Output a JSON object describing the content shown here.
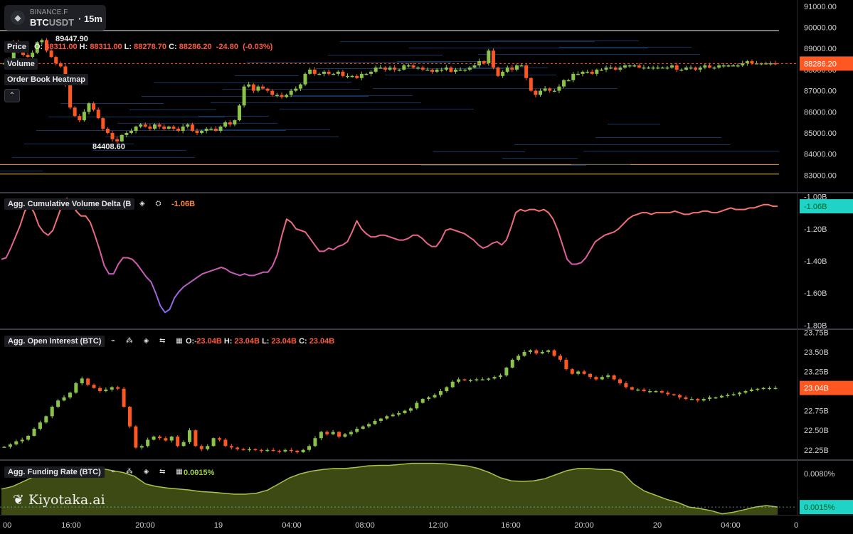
{
  "symbol": {
    "exchange": "BINANCE.F",
    "base": "BTC",
    "quote": "USDT",
    "timeframe": "15m",
    "exchange_icon": "binance-diamond-icon"
  },
  "brand": "Kiyotaka.ai",
  "legend": {
    "price_label": "Price",
    "volume_label": "Volume",
    "heatmap_label": "Order Book Heatmap",
    "o_key": "O:",
    "o_val": "88311.00",
    "h_key": "H:",
    "h_val": "88311.00",
    "l_key": "L:",
    "l_val": "88278.70",
    "c_key": "C:",
    "c_val": "88286.20",
    "change": "-24.80",
    "change_pct": "(-0.03%)",
    "collapse_icon": "chevron-up-icon"
  },
  "colors": {
    "up": "#8bc34a",
    "down": "#ff5722",
    "bg": "#000000",
    "cvd_badge": "#1fd3c6",
    "oi_badge": "#ff5722",
    "funding_fill": "#3d4a14",
    "funding_line": "#a9c44a"
  },
  "time_axis": {
    "labels": [
      "00",
      "16:00",
      "20:00",
      "19",
      "04:00",
      "08:00",
      "12:00",
      "16:00",
      "20:00",
      "20",
      "04:00",
      "0"
    ]
  },
  "chart_data": [
    {
      "type": "candlestick",
      "name": "Price",
      "ylim": [
        82200,
        91300
      ],
      "y_ticks": [
        "91000.00",
        "90000.00",
        "89000.00",
        "88000.00",
        "87000.00",
        "86000.00",
        "85000.00",
        "84000.00",
        "83000.00"
      ],
      "y_tick_values": [
        91000,
        90000,
        89000,
        88000,
        87000,
        86000,
        85000,
        84000,
        83000
      ],
      "last_price": "88286.20",
      "last_value": 88286.2,
      "annotations": [
        {
          "text": "89447.90",
          "value": 89447.9
        },
        {
          "text": "84408.60",
          "value": 84408.6
        }
      ],
      "heatmap_levels": [
        89850,
        83500,
        83050
      ],
      "close_path": [
        88300,
        88500,
        89300,
        88900,
        88700,
        88600,
        88800,
        89300,
        89400,
        88900,
        88600,
        88300,
        88150,
        87300,
        86200,
        85800,
        85600,
        86000,
        86400,
        86100,
        85700,
        85200,
        85000,
        84700,
        84600,
        84900,
        85000,
        85100,
        85300,
        85400,
        85300,
        85200,
        85400,
        85300,
        85200,
        85300,
        85200,
        85100,
        85300,
        85400,
        85100,
        85000,
        85100,
        85200,
        85200,
        85100,
        85300,
        85500,
        85400,
        85600,
        86300,
        87200,
        87300,
        87000,
        87200,
        87100,
        87000,
        86800,
        86800,
        86700,
        86800,
        87000,
        87100,
        87300,
        87800,
        88000,
        87800,
        87800,
        87900,
        87800,
        87800,
        87900,
        87700,
        87700,
        87700,
        87600,
        87800,
        87800,
        87900,
        88100,
        88100,
        88000,
        88100,
        88000,
        88000,
        88200,
        88200,
        88100,
        88100,
        88000,
        88000,
        87900,
        88000,
        88000,
        88100,
        87900,
        88000,
        88000,
        88000,
        88100,
        88200,
        88400,
        88300,
        88900,
        88100,
        87700,
        87900,
        88100,
        88000,
        88200,
        88200,
        87600,
        87000,
        86800,
        87000,
        87100,
        87000,
        87000,
        87200,
        87500,
        87500,
        87800,
        87800,
        87900,
        87900,
        87800,
        88000,
        88000,
        88100,
        88100,
        88000,
        88100,
        88200,
        88200,
        88200,
        88100,
        88100,
        88100,
        88100,
        88100,
        88100,
        88100,
        88200,
        88000,
        88000,
        88100,
        88100,
        88000,
        88100,
        88200,
        88100,
        88100,
        88200,
        88200,
        88200,
        88200,
        88200,
        88300,
        88400,
        88300,
        88300,
        88300,
        88300,
        88300,
        88286
      ]
    },
    {
      "type": "line",
      "name": "Agg. Cumulative Volume Delta (B",
      "value_label": "-1.06B",
      "ylim": [
        -1.82,
        -0.98
      ],
      "y_ticks": [
        "-1.00B",
        "-1.20B",
        "-1.40B",
        "-1.60B",
        "-1.80B"
      ],
      "y_tick_values": [
        -1.0,
        -1.2,
        -1.4,
        -1.6,
        -1.8
      ],
      "last_value": -1.06,
      "points": [
        -1.39,
        -1.38,
        -1.32,
        -1.25,
        -1.18,
        -1.09,
        -1.05,
        -1.1,
        -1.18,
        -1.22,
        -1.24,
        -1.21,
        -1.13,
        -1.05,
        -1.01,
        -1.04,
        -1.09,
        -1.12,
        -1.12,
        -1.16,
        -1.24,
        -1.33,
        -1.43,
        -1.48,
        -1.48,
        -1.42,
        -1.38,
        -1.38,
        -1.39,
        -1.42,
        -1.46,
        -1.5,
        -1.53,
        -1.6,
        -1.68,
        -1.72,
        -1.7,
        -1.63,
        -1.59,
        -1.56,
        -1.54,
        -1.52,
        -1.5,
        -1.48,
        -1.47,
        -1.46,
        -1.45,
        -1.44,
        -1.45,
        -1.47,
        -1.48,
        -1.49,
        -1.48,
        -1.49,
        -1.49,
        -1.48,
        -1.47,
        -1.47,
        -1.43,
        -1.36,
        -1.24,
        -1.14,
        -1.16,
        -1.2,
        -1.21,
        -1.22,
        -1.26,
        -1.3,
        -1.34,
        -1.34,
        -1.32,
        -1.33,
        -1.31,
        -1.3,
        -1.28,
        -1.22,
        -1.15,
        -1.2,
        -1.23,
        -1.25,
        -1.25,
        -1.24,
        -1.24,
        -1.25,
        -1.26,
        -1.27,
        -1.27,
        -1.26,
        -1.24,
        -1.24,
        -1.26,
        -1.29,
        -1.31,
        -1.31,
        -1.27,
        -1.21,
        -1.2,
        -1.21,
        -1.22,
        -1.23,
        -1.25,
        -1.27,
        -1.3,
        -1.32,
        -1.31,
        -1.29,
        -1.28,
        -1.3,
        -1.27,
        -1.19,
        -1.1,
        -1.08,
        -1.09,
        -1.08,
        -1.08,
        -1.09,
        -1.08,
        -1.1,
        -1.14,
        -1.21,
        -1.3,
        -1.39,
        -1.42,
        -1.42,
        -1.41,
        -1.38,
        -1.33,
        -1.28,
        -1.26,
        -1.24,
        -1.23,
        -1.22,
        -1.2,
        -1.17,
        -1.14,
        -1.12,
        -1.11,
        -1.1,
        -1.1,
        -1.11,
        -1.1,
        -1.1,
        -1.1,
        -1.1,
        -1.09,
        -1.1,
        -1.11,
        -1.11,
        -1.1,
        -1.1,
        -1.09,
        -1.09,
        -1.1,
        -1.1,
        -1.09,
        -1.08,
        -1.07,
        -1.08,
        -1.08,
        -1.08,
        -1.07,
        -1.07,
        -1.06,
        -1.05,
        -1.05,
        -1.06,
        -1.06
      ]
    },
    {
      "type": "candlestick",
      "name": "Agg. Open Interest (BTC)",
      "ohlc": {
        "o_key": "O:",
        "o": "23.04B",
        "h_key": "H:",
        "h": "23.04B",
        "l_key": "L:",
        "l": "23.04B",
        "c_key": "C:",
        "c": "23.04B"
      },
      "ylim": [
        22.13,
        23.78
      ],
      "y_ticks": [
        "23.75B",
        "23.50B",
        "23.25B",
        "23.00B",
        "22.75B",
        "22.50B",
        "22.25B"
      ],
      "y_tick_values": [
        23.75,
        23.5,
        23.25,
        23.0,
        22.75,
        22.5,
        22.25
      ],
      "last_value": "23.04B",
      "last_numeric": 23.04,
      "close_path": [
        22.29,
        22.32,
        22.36,
        22.38,
        22.43,
        22.52,
        22.6,
        22.68,
        22.8,
        22.88,
        22.92,
        22.98,
        23.1,
        23.16,
        23.08,
        23.04,
        23.0,
        23.02,
        23.05,
        23.03,
        22.8,
        22.55,
        22.28,
        22.3,
        22.38,
        22.42,
        22.4,
        22.37,
        22.42,
        22.3,
        22.35,
        22.5,
        22.3,
        22.26,
        22.3,
        22.4,
        22.38,
        22.3,
        22.28,
        22.26,
        22.25,
        22.26,
        22.25,
        22.24,
        22.25,
        22.24,
        22.23,
        22.25,
        22.24,
        22.22,
        22.25,
        22.3,
        22.4,
        22.48,
        22.45,
        22.48,
        22.42,
        22.45,
        22.48,
        22.52,
        22.55,
        22.58,
        22.62,
        22.65,
        22.68,
        22.7,
        22.72,
        22.75,
        22.78,
        22.85,
        22.9,
        22.92,
        22.95,
        23.0,
        23.05,
        23.12,
        23.15,
        23.14,
        23.14,
        23.15,
        23.15,
        23.16,
        23.18,
        23.2,
        23.3,
        23.4,
        23.45,
        23.5,
        23.52,
        23.48,
        23.5,
        23.52,
        23.45,
        23.4,
        23.28,
        23.22,
        23.25,
        23.22,
        23.18,
        23.15,
        23.18,
        23.2,
        23.15,
        23.1,
        23.05,
        23.02,
        23.02,
        23.0,
        23.0,
        23.0,
        22.98,
        22.96,
        22.95,
        22.92,
        22.9,
        22.9,
        22.88,
        22.9,
        22.92,
        22.92,
        22.94,
        22.95,
        22.96,
        22.98,
        23.0,
        23.02,
        23.03,
        23.04,
        23.04,
        23.04
      ]
    },
    {
      "type": "area",
      "name": "Agg. Funding Rate (BTC)",
      "value_label": "0.0015%",
      "ylim": [
        0.0,
        0.0105
      ],
      "y_ticks": [
        "0.0080%",
        "0.0015%"
      ],
      "y_tick_values": [
        0.008,
        0.0015
      ],
      "last_value": 0.0015,
      "points": [
        0.005,
        0.0055,
        0.0065,
        0.0075,
        0.0085,
        0.009,
        0.0092,
        0.0093,
        0.0093,
        0.009,
        0.0086,
        0.0082,
        0.0075,
        0.006,
        0.0055,
        0.0052,
        0.005,
        0.0048,
        0.0045,
        0.0044,
        0.0042,
        0.004,
        0.004,
        0.0042,
        0.0048,
        0.006,
        0.0072,
        0.008,
        0.0085,
        0.0088,
        0.009,
        0.009,
        0.0092,
        0.0095,
        0.0096,
        0.0096,
        0.0098,
        0.01,
        0.01,
        0.01,
        0.0099,
        0.0097,
        0.0095,
        0.009,
        0.0082,
        0.0072,
        0.0066,
        0.0065,
        0.0066,
        0.007,
        0.0078,
        0.0086,
        0.009,
        0.009,
        0.0088,
        0.0088,
        0.0082,
        0.006,
        0.0046,
        0.0038,
        0.003,
        0.0024,
        0.0015,
        0.0012,
        0.0008,
        0.0002,
        0.0005,
        0.001,
        0.0015,
        0.0018,
        0.0015
      ]
    }
  ],
  "indicator_icons": [
    "settings-icon",
    "eye-icon",
    "data-icon",
    "source-icon",
    "grid-icon",
    "arrows-icon"
  ],
  "indicator_icon_glyphs": {
    "cvd": "◈  ⛭",
    "oi": "⌁ ⁂ ◈ ⇆ ▦ ↔",
    "fr": "⌁ ⁂ ◈ ⇆ ▦ ↔"
  }
}
